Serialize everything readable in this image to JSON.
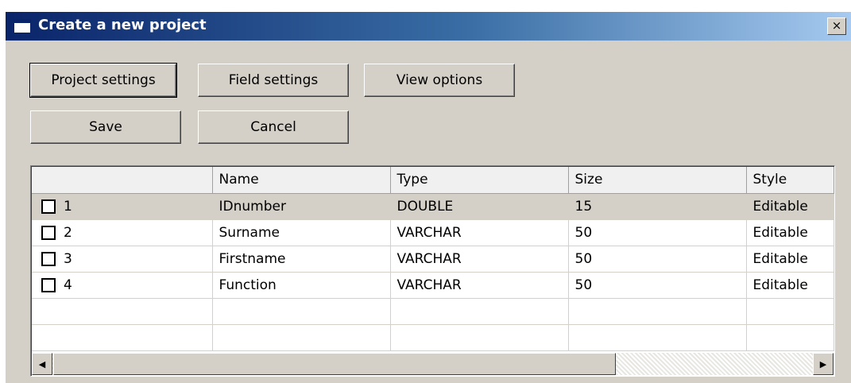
{
  "window": {
    "title": "Create a new project",
    "close_label": "×"
  },
  "buttons": {
    "project_settings": "Project settings",
    "field_settings": "Field settings",
    "view_options": "View options",
    "save": "Save",
    "cancel": "Cancel"
  },
  "grid": {
    "columns": [
      "",
      "Name",
      "Type",
      "Size",
      "Style"
    ],
    "rows": [
      {
        "num": "1",
        "name": "IDnumber",
        "type": "DOUBLE",
        "size": "15",
        "style": "Editable",
        "selected": true
      },
      {
        "num": "2",
        "name": "Surname",
        "type": "VARCHAR",
        "size": "50",
        "style": "Editable"
      },
      {
        "num": "3",
        "name": "Firstname",
        "type": "VARCHAR",
        "size": "50",
        "style": "Editable"
      },
      {
        "num": "4",
        "name": "Function",
        "type": "VARCHAR",
        "size": "50",
        "style": "Editable"
      }
    ]
  },
  "scrollbar": {
    "left_icon": "◀",
    "right_icon": "▶"
  },
  "colors": {
    "titlebar_start": "#0a246a",
    "titlebar_end": "#a6caf0",
    "face": "#d4d0c8"
  }
}
